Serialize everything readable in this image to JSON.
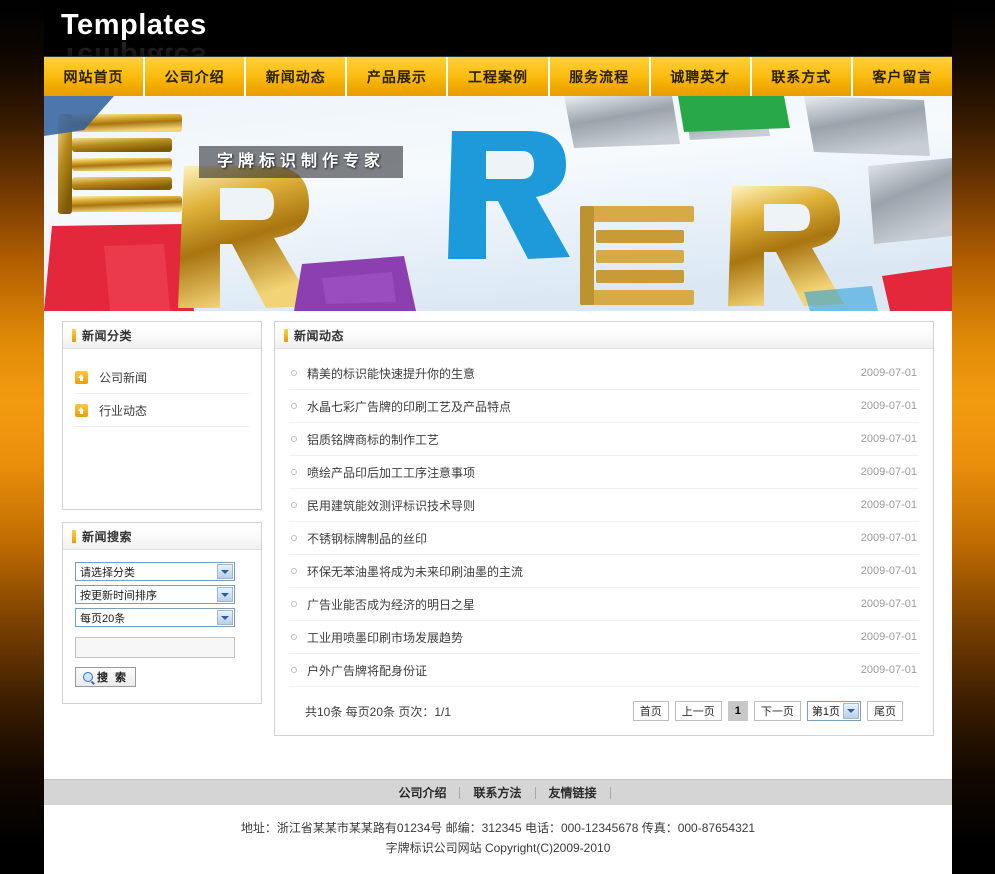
{
  "site": {
    "logo_text": "Templates",
    "banner_caption": "字牌标识制作专家"
  },
  "nav": {
    "items": [
      {
        "label": "网站首页"
      },
      {
        "label": "公司介绍"
      },
      {
        "label": "新闻动态"
      },
      {
        "label": "产品展示"
      },
      {
        "label": "工程案例"
      },
      {
        "label": "服务流程"
      },
      {
        "label": "诚聘英才"
      },
      {
        "label": "联系方式"
      },
      {
        "label": "客户留言"
      }
    ]
  },
  "sidebar": {
    "category_panel": {
      "title": "新闻分类",
      "items": [
        {
          "label": "公司新闻",
          "icon": "up-arrow-icon"
        },
        {
          "label": "行业动态",
          "icon": "up-arrow-icon"
        }
      ]
    },
    "search_panel": {
      "title": "新闻搜索",
      "select_category": "请选择分类",
      "select_sort": "按更新时间排序",
      "select_pagesize": "每页20条",
      "keyword_value": "",
      "keyword_placeholder": "",
      "search_button": "搜 索",
      "search_icon": "magnifier-icon"
    }
  },
  "news": {
    "title": "新闻动态",
    "items": [
      {
        "title": "精美的标识能快速提升你的生意",
        "date": "2009-07-01"
      },
      {
        "title": "水晶七彩广告牌的印刷工艺及产品特点",
        "date": "2009-07-01"
      },
      {
        "title": "铝质铭牌商标的制作工艺",
        "date": "2009-07-01"
      },
      {
        "title": "喷绘产品印后加工工序注意事项",
        "date": "2009-07-01"
      },
      {
        "title": "民用建筑能效测评标识技术导则",
        "date": "2009-07-01"
      },
      {
        "title": "不锈钢标牌制品的丝印",
        "date": "2009-07-01"
      },
      {
        "title": "环保无苯油墨将成为未来印刷油墨的主流",
        "date": "2009-07-01"
      },
      {
        "title": "广告业能否成为经济的明日之星",
        "date": "2009-07-01"
      },
      {
        "title": "工业用喷墨印刷市场发展趋势",
        "date": "2009-07-01"
      },
      {
        "title": "户外广告牌将配身份证",
        "date": "2009-07-01"
      }
    ]
  },
  "pager": {
    "info": "共10条 每页20条 页次：1/1",
    "first": "首页",
    "prev": "上一页",
    "current": "1",
    "next": "下一页",
    "page_select": "第1页",
    "last": "尾页"
  },
  "footer": {
    "links": [
      {
        "label": "公司介绍"
      },
      {
        "label": "联系方法"
      },
      {
        "label": "友情链接"
      }
    ],
    "address_line": "地址：浙江省某某市某某路有01234号  邮编：312345 电话：000-12345678 传真：000-87654321",
    "copyright_line": "字牌标识公司网站  Copyright(C)2009-2010"
  },
  "colors": {
    "nav_gold": "#fbbd10",
    "accent_orange": "#e79b05",
    "side_gradient": "#f29b10",
    "footer_bar": "#d5d5d5"
  }
}
